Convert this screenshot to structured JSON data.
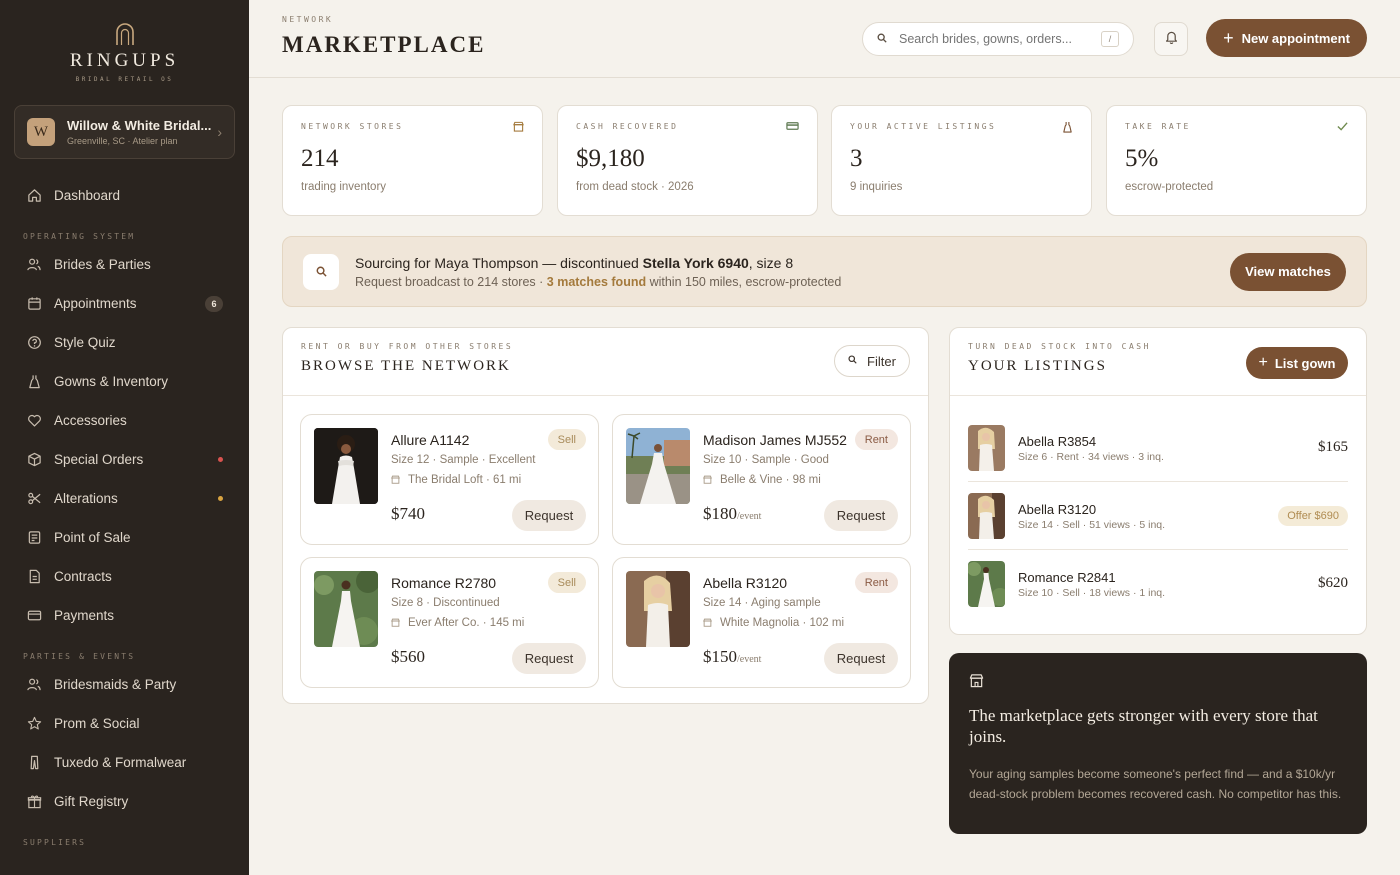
{
  "brand": {
    "name": "RINGUPS",
    "tagline": "BRIDAL RETAIL OS"
  },
  "store": {
    "initial": "W",
    "name": "Willow & White Bridal...",
    "meta": "Greenville, SC · Atelier plan"
  },
  "nav": {
    "dashboard": "Dashboard",
    "section_operating": "OPERATING SYSTEM",
    "brides": "Brides & Parties",
    "appointments": "Appointments",
    "appointments_badge": "6",
    "style_quiz": "Style Quiz",
    "gowns": "Gowns & Inventory",
    "accessories": "Accessories",
    "special_orders": "Special Orders",
    "alterations": "Alterations",
    "pos": "Point of Sale",
    "contracts": "Contracts",
    "payments": "Payments",
    "section_parties": "PARTIES & EVENTS",
    "bridesmaids": "Bridesmaids & Party",
    "prom": "Prom & Social",
    "tuxedo": "Tuxedo & Formalwear",
    "gift": "Gift Registry",
    "section_suppliers": "SUPPLIERS"
  },
  "header": {
    "kicker": "NETWORK",
    "title": "MARKETPLACE",
    "search_placeholder": "Search brides, gowns, orders...",
    "search_shortcut": "/",
    "new_appointment": "New appointment"
  },
  "stats": [
    {
      "label": "NETWORK STORES",
      "value": "214",
      "sub": "trading inventory"
    },
    {
      "label": "CASH RECOVERED",
      "value": "$9,180",
      "sub": "from dead stock · 2026"
    },
    {
      "label": "YOUR ACTIVE LISTINGS",
      "value": "3",
      "sub": "9 inquiries"
    },
    {
      "label": "TAKE RATE",
      "value": "5%",
      "sub": "escrow-protected"
    }
  ],
  "banner": {
    "line1_pre": "Sourcing for Maya Thompson — discontinued ",
    "line1_bold": "Stella York 6940",
    "line1_post": ", size 8",
    "line2_pre": "Request broadcast to 214 stores · ",
    "line2_hl": "3 matches found",
    "line2_post": " within 150 miles, escrow-protected",
    "button": "View matches"
  },
  "browse": {
    "kicker": "RENT OR BUY FROM OTHER STORES",
    "title": "BROWSE THE NETWORK",
    "filter": "Filter",
    "cards": [
      {
        "name": "Allure A1142",
        "tag": "Sell",
        "meta": "Size 12 · Sample · Excellent",
        "store": "The Bridal Loft · 61 mi",
        "price": "$740",
        "unit": "",
        "button": "Request"
      },
      {
        "name": "Madison James MJ552",
        "tag": "Rent",
        "meta": "Size 10 · Sample · Good",
        "store": "Belle & Vine · 98 mi",
        "price": "$180",
        "unit": "/event",
        "button": "Request"
      },
      {
        "name": "Romance R2780",
        "tag": "Sell",
        "meta": "Size 8 · Discontinued",
        "store": "Ever After Co. · 145 mi",
        "price": "$560",
        "unit": "",
        "button": "Request"
      },
      {
        "name": "Abella R3120",
        "tag": "Rent",
        "meta": "Size 14 · Aging sample",
        "store": "White Magnolia · 102 mi",
        "price": "$150",
        "unit": "/event",
        "button": "Request"
      }
    ]
  },
  "listings": {
    "kicker": "TURN DEAD STOCK INTO CASH",
    "title": "YOUR LISTINGS",
    "button": "List gown",
    "rows": [
      {
        "name": "Abella R3854",
        "meta": "Size 6 · Rent · 34 views · 3 inq.",
        "value": "$165"
      },
      {
        "name": "Abella R3120",
        "meta": "Size 14 · Sell · 51 views · 5 inq.",
        "value": "Offer $690"
      },
      {
        "name": "Romance R2841",
        "meta": "Size 10 · Sell · 18 views · 1 inq.",
        "value": "$620"
      }
    ]
  },
  "promo": {
    "title": "The marketplace gets stronger with every store that joins.",
    "body": "Your aging samples become someone's perfect find — and a $10k/yr dead-stock problem becomes recovered cash. No competitor has this."
  },
  "colors": {
    "accent": "#7a5133",
    "sidebar": "#2a241f",
    "dot_red": "#d9534f",
    "dot_amber": "#d9a441",
    "highlight": "#a47a3c"
  }
}
